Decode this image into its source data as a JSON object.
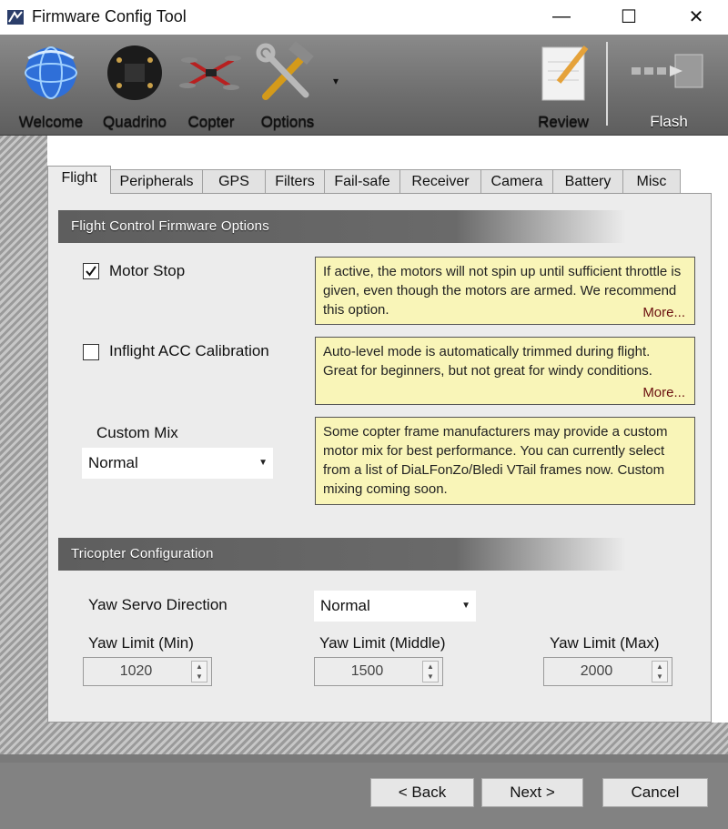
{
  "window": {
    "title": "Firmware Config Tool",
    "min": "—",
    "max": "☐",
    "close": "✕"
  },
  "toolbar": {
    "items": [
      {
        "label": "Welcome"
      },
      {
        "label": "Quadrino"
      },
      {
        "label": "Copter"
      },
      {
        "label": "Options"
      },
      {
        "label": "Review"
      },
      {
        "label": "Flash"
      }
    ],
    "options_dropdown": "▾"
  },
  "tabs": [
    "Flight",
    "Peripherals",
    "GPS",
    "Filters",
    "Fail-safe",
    "Receiver",
    "Camera",
    "Battery",
    "Misc"
  ],
  "flight": {
    "section_title": "Flight Control Firmware Options",
    "motor_stop": {
      "label": "Motor Stop",
      "checked": true,
      "note": "If active, the motors will not spin up until sufficient throttle is given, even though the motors are armed. We recommend this option.",
      "more": "More..."
    },
    "acc_calibration": {
      "label": "Inflight ACC Calibration",
      "checked": false,
      "note": "Auto-level mode is automatically trimmed during flight. Great for beginners, but not great for windy conditions.",
      "more": "More..."
    },
    "custom_mix": {
      "label": "Custom Mix",
      "value": "Normal",
      "note": "Some copter frame manufacturers may provide a custom motor mix for best performance. You can currently select from a list of DiaLFonZo/Bledi VTail frames now. Custom mixing coming soon."
    }
  },
  "tricopter": {
    "section_title": "Tricopter Configuration",
    "yaw_servo_direction": {
      "label": "Yaw Servo Direction",
      "value": "Normal"
    },
    "yaw_limit_min": {
      "label": "Yaw Limit (Min)",
      "value": "1020"
    },
    "yaw_limit_middle": {
      "label": "Yaw Limit (Middle)",
      "value": "1500"
    },
    "yaw_limit_max": {
      "label": "Yaw Limit (Max)",
      "value": "2000"
    }
  },
  "footer": {
    "back": "< Back",
    "next": "Next >",
    "cancel": "Cancel"
  }
}
